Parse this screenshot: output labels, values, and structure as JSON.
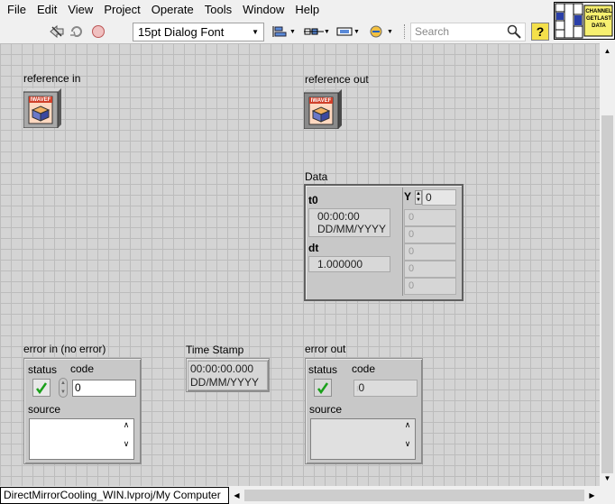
{
  "menu": [
    "File",
    "Edit",
    "View",
    "Project",
    "Operate",
    "Tools",
    "Window",
    "Help"
  ],
  "toolbar": {
    "font_label": "15pt Dialog Font",
    "search_placeholder": "Search",
    "help_label": "?"
  },
  "connector_icon": {
    "lines": [
      "CHANNEL",
      "GETLAST",
      "DATA"
    ]
  },
  "controls": {
    "reference_in": {
      "label": "reference in",
      "icon_text": "IWAVEF"
    },
    "reference_out": {
      "label": "reference out",
      "icon_text": "IWAVEF"
    },
    "data": {
      "label": "Data",
      "t0_label": "t0",
      "t0_time": "00:00:00",
      "t0_date": "DD/MM/YYYY",
      "dt_label": "dt",
      "dt_value": "1.000000",
      "y_label": "Y",
      "y_index": "0",
      "y_values": [
        "0",
        "0",
        "0",
        "0",
        "0"
      ]
    },
    "error_in": {
      "label": "error in (no error)",
      "status_label": "status",
      "code_label": "code",
      "code_value": "0",
      "source_label": "source"
    },
    "time_stamp": {
      "label": "Time Stamp",
      "time": "00:00:00.000",
      "date": "DD/MM/YYYY"
    },
    "error_out": {
      "label": "error out",
      "status_label": "status",
      "code_label": "code",
      "code_value": "0",
      "source_label": "source"
    }
  },
  "statusbar": {
    "path": "DirectMirrorCooling_WIN.lvproj/My Computer"
  },
  "colors": {
    "panel_bg": "#d4d4d4",
    "grid": "#bcbcbc",
    "help_yellow": "#f4e04a",
    "check_green": "#1aa01a"
  }
}
